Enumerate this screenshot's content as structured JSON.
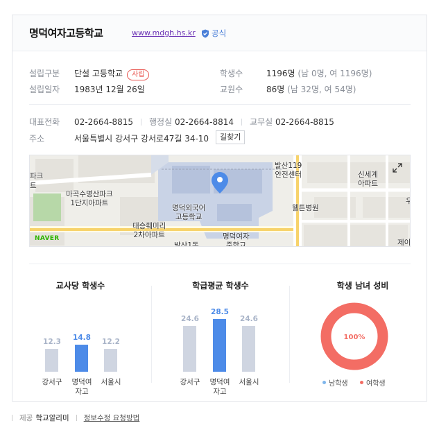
{
  "header": {
    "title": "명덕여자고등학교",
    "url": "www.mdgh.hs.kr",
    "official_label": "공식"
  },
  "info": {
    "founding_type_label": "설립구분",
    "founding_type_value": "단설 고등학교",
    "founding_type_tag": "사립",
    "founding_date_label": "설립일자",
    "founding_date_value": "1983년 12월 26일",
    "students_label": "학생수",
    "students_value": "1196명",
    "students_detail": "(남 0명, 여 1196명)",
    "teachers_label": "교원수",
    "teachers_value": "86명",
    "teachers_detail": "(남 32명, 여 54명)",
    "phone_label": "대표전화",
    "phone_value": "02-2664-8815",
    "admin_label": "행정실",
    "admin_value": "02-2664-8814",
    "academic_label": "교무실",
    "academic_value": "02-2664-8815",
    "address_label": "주소",
    "address_value": "서울특별시 강서구 강서로47길 34-10",
    "directions_button": "길찾기"
  },
  "map": {
    "labels": {
      "park_apt_top": "마곡수명산파크",
      "park_apt_bottom": "1단지아파트",
      "left_edge": "파크",
      "left_edge2": "트",
      "fire_top": "발산119",
      "fire_bottom": "안전센터",
      "lang_top": "명덕외국어",
      "lang_bottom": "고등학교",
      "hill_top": "태승훼미리",
      "hill_bottom": "2차아파트",
      "hospital": "웰튼병원",
      "sinsegye_top": "신세계",
      "sinsegye_bottom": "아파트",
      "girls_mid_top": "명덕여자",
      "girls_mid_bottom": "중학교",
      "balsan": "발산1동",
      "right_edge": "우",
      "right_edge2": "제이"
    },
    "provider": "NAVER",
    "expand_icon": "expand-icon",
    "pin_icon": "location-pin-icon"
  },
  "stats": {
    "teacher_ratio_title": "교사당 학생수",
    "class_avg_title": "학급평균 학생수",
    "gender_title": "학생 남녀 성비",
    "gender_percent": "100%",
    "legend_male": "남학생",
    "legend_female": "여학생",
    "colors": {
      "gray": "#cfd5e1",
      "blue": "#4d8be8",
      "female": "#f36d64",
      "male": "#7eb6ec"
    }
  },
  "chart_data": [
    {
      "type": "bar",
      "title": "교사당 학생수",
      "categories": [
        "강서구",
        "명덕여자고",
        "서울시"
      ],
      "category_labels": [
        [
          "강서구"
        ],
        [
          "명덕여",
          "자고"
        ],
        [
          "서울시"
        ]
      ],
      "values": [
        12.3,
        14.8,
        12.2
      ],
      "value_labels": [
        "12.3",
        "14.8",
        "12.2"
      ],
      "highlight_index": 1,
      "ylim": [
        0,
        30
      ]
    },
    {
      "type": "bar",
      "title": "학급평균 학생수",
      "categories": [
        "강서구",
        "명덕여자고",
        "서울시"
      ],
      "category_labels": [
        [
          "강서구"
        ],
        [
          "명덕여",
          "자고"
        ],
        [
          "서울시"
        ]
      ],
      "values": [
        24.6,
        28.5,
        24.6
      ],
      "value_labels": [
        "24.6",
        "28.5",
        "24.6"
      ],
      "highlight_index": 1,
      "ylim": [
        0,
        30
      ]
    },
    {
      "type": "pie",
      "title": "학생 남녀 성비",
      "categories": [
        "남학생",
        "여학생"
      ],
      "values": [
        0,
        100
      ]
    }
  ],
  "footer": {
    "provider_label": "제공",
    "provider_name": "학교알리미",
    "edit_link": "정보수정 요청방법"
  }
}
